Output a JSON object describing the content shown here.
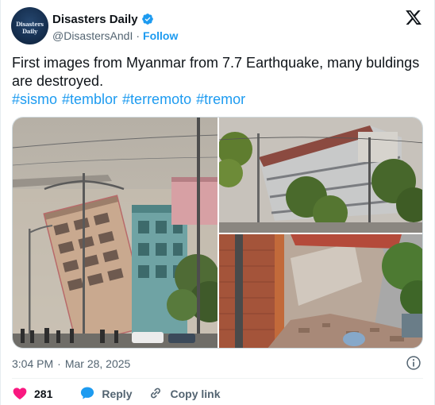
{
  "author": {
    "display_name": "Disasters Daily",
    "handle": "@DisastersAndI",
    "follow_label": "Follow",
    "avatar_text": "Disasters Daily",
    "avatar_subtext": "",
    "verified": true
  },
  "tweet": {
    "text": "First images from Myanmar from 7.7 Earthquake, many buldings are destroyed.",
    "hashtags": [
      "#sismo",
      "#temblor",
      "#terremoto",
      "#tremor"
    ]
  },
  "meta": {
    "time": "3:04 PM",
    "separator": "·",
    "date": "Mar 28, 2025"
  },
  "actions": {
    "like_count": "281",
    "reply_label": "Reply",
    "copy_link_label": "Copy link"
  },
  "icons": {
    "logo": "x-logo-icon",
    "verified": "verified-badge-icon",
    "info": "info-icon",
    "like": "heart-icon",
    "reply": "speech-bubble-icon",
    "link": "link-icon"
  },
  "colors": {
    "accent": "#1d9bf0",
    "like": "#f91880",
    "muted": "#536471",
    "text": "#0f1419"
  }
}
